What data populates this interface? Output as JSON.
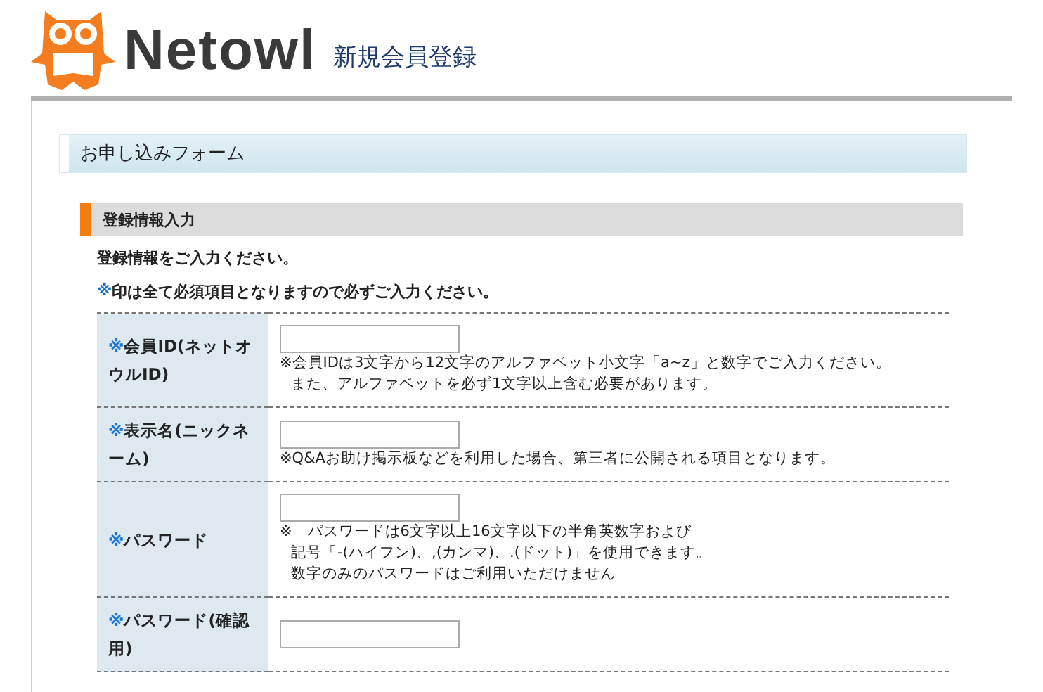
{
  "header": {
    "logo_text": "Netowl",
    "page_title": "新規会員登録"
  },
  "section_title": "お申し込みフォーム",
  "subsection_title": "登録情報入力",
  "intro": "登録情報をご入力ください。",
  "required_note": {
    "mark": "※",
    "text": "印は全て必須項目となりますので必ずご入力ください。"
  },
  "fields": [
    {
      "mark": "※",
      "label": "会員ID(ネットオウルID)",
      "hint_lines": [
        "※会員IDは3文字から12文字のアルファベット小文字「a~z」と数字でご入力ください。",
        "また、アルファベットを必ず1文字以上含む必要があります。"
      ]
    },
    {
      "mark": "※",
      "label": "表示名(ニックネーム)",
      "hint_lines": [
        "※Q&Aお助け掲示板などを利用した場合、第三者に公開される項目となります。"
      ]
    },
    {
      "mark": "※",
      "label": "パスワード",
      "hint_lines": [
        "※　パスワードは6文字以上16文字以下の半角英数字および",
        "記号「-(ハイフン)、,(カンマ)、.(ドット)」を使用できます。",
        "数字のみのパスワードはご利用いただけません"
      ]
    },
    {
      "mark": "※",
      "label": "パスワード(確認用)"
    }
  ]
}
